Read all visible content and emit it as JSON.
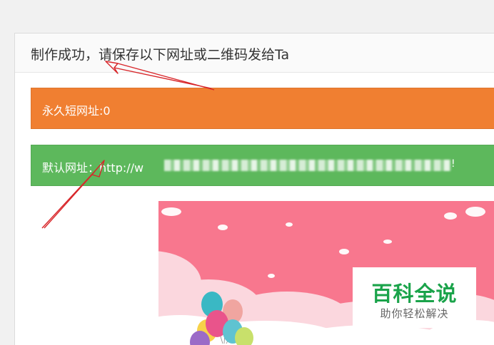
{
  "panel": {
    "title": "制作成功，请保存以下网址或二维码发给Ta"
  },
  "short_url_bar": {
    "label": "永久短网址:0"
  },
  "default_url_bar": {
    "label": "默认网址：http://w",
    "tail": "!"
  },
  "watermark": {
    "title": "百科全说",
    "subtitle": "助你轻松解决"
  },
  "colors": {
    "orange_bar": "#f07f31",
    "green_bar": "#5db85c",
    "annotation_arrow": "#d8262a",
    "poster_pink": "#f8778e",
    "watermark_green": "#1aa34a"
  }
}
